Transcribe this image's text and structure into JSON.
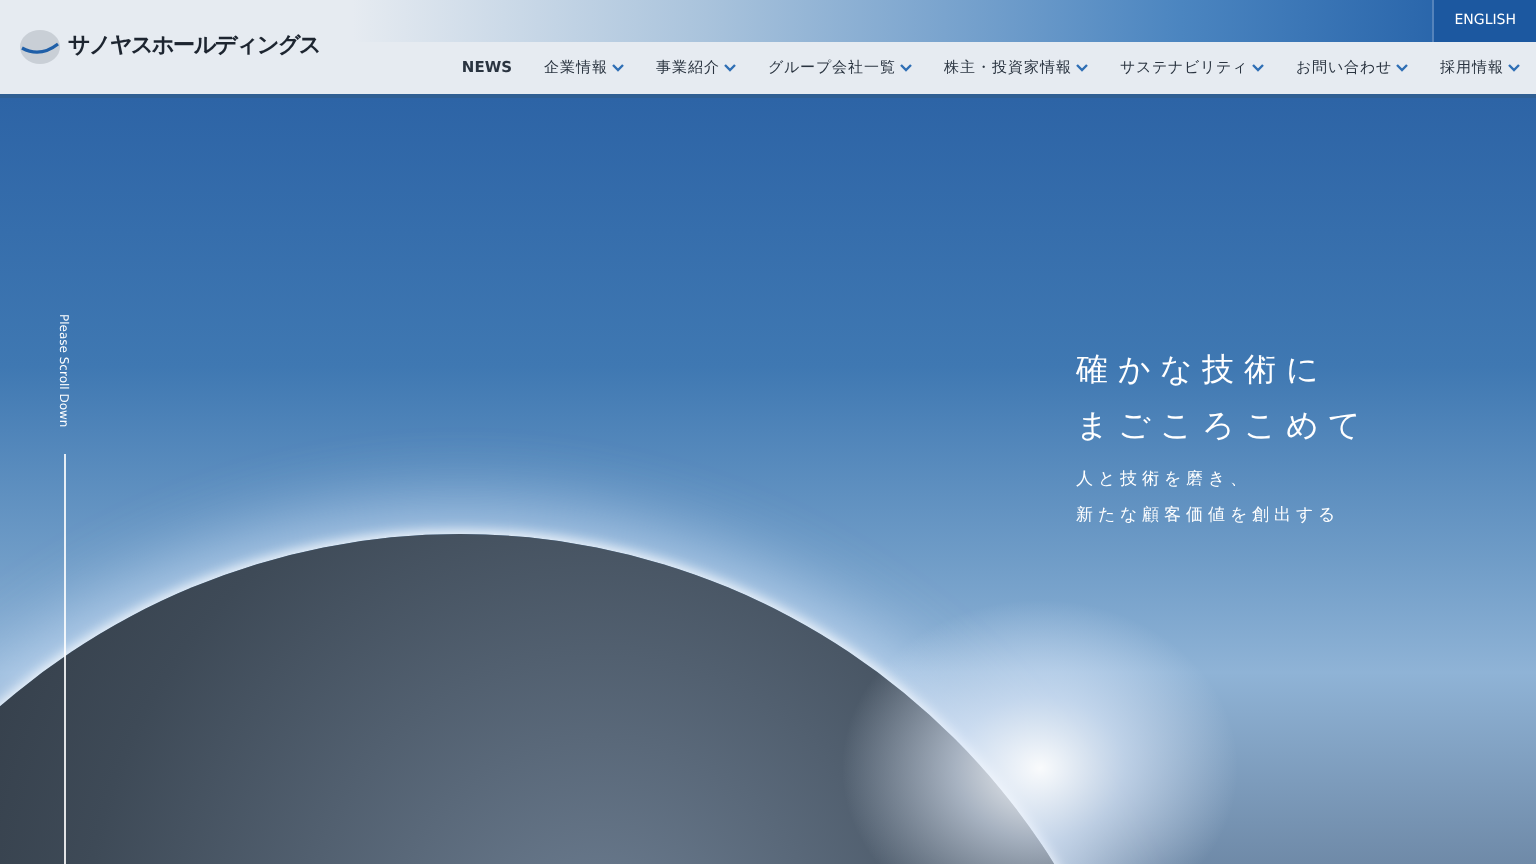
{
  "header": {
    "logo_text": "サノヤスホールディングス",
    "language_link": "ENGLISH",
    "nav": [
      {
        "label": "NEWS",
        "dropdown": false
      },
      {
        "label": "企業情報",
        "dropdown": true
      },
      {
        "label": "事業紹介",
        "dropdown": true
      },
      {
        "label": "グループ会社一覧",
        "dropdown": true
      },
      {
        "label": "株主・投資家情報",
        "dropdown": true
      },
      {
        "label": "サステナビリティ",
        "dropdown": true
      },
      {
        "label": "お問い合わせ",
        "dropdown": true
      },
      {
        "label": "採用情報",
        "dropdown": true
      }
    ]
  },
  "hero": {
    "headline_lines": [
      "確かな技術に",
      "まごころこめて"
    ],
    "sub_lines": [
      "人と技術を磨き、",
      "新たな顧客価値を創出する"
    ],
    "scroll_hint": "Please Scroll Down"
  }
}
